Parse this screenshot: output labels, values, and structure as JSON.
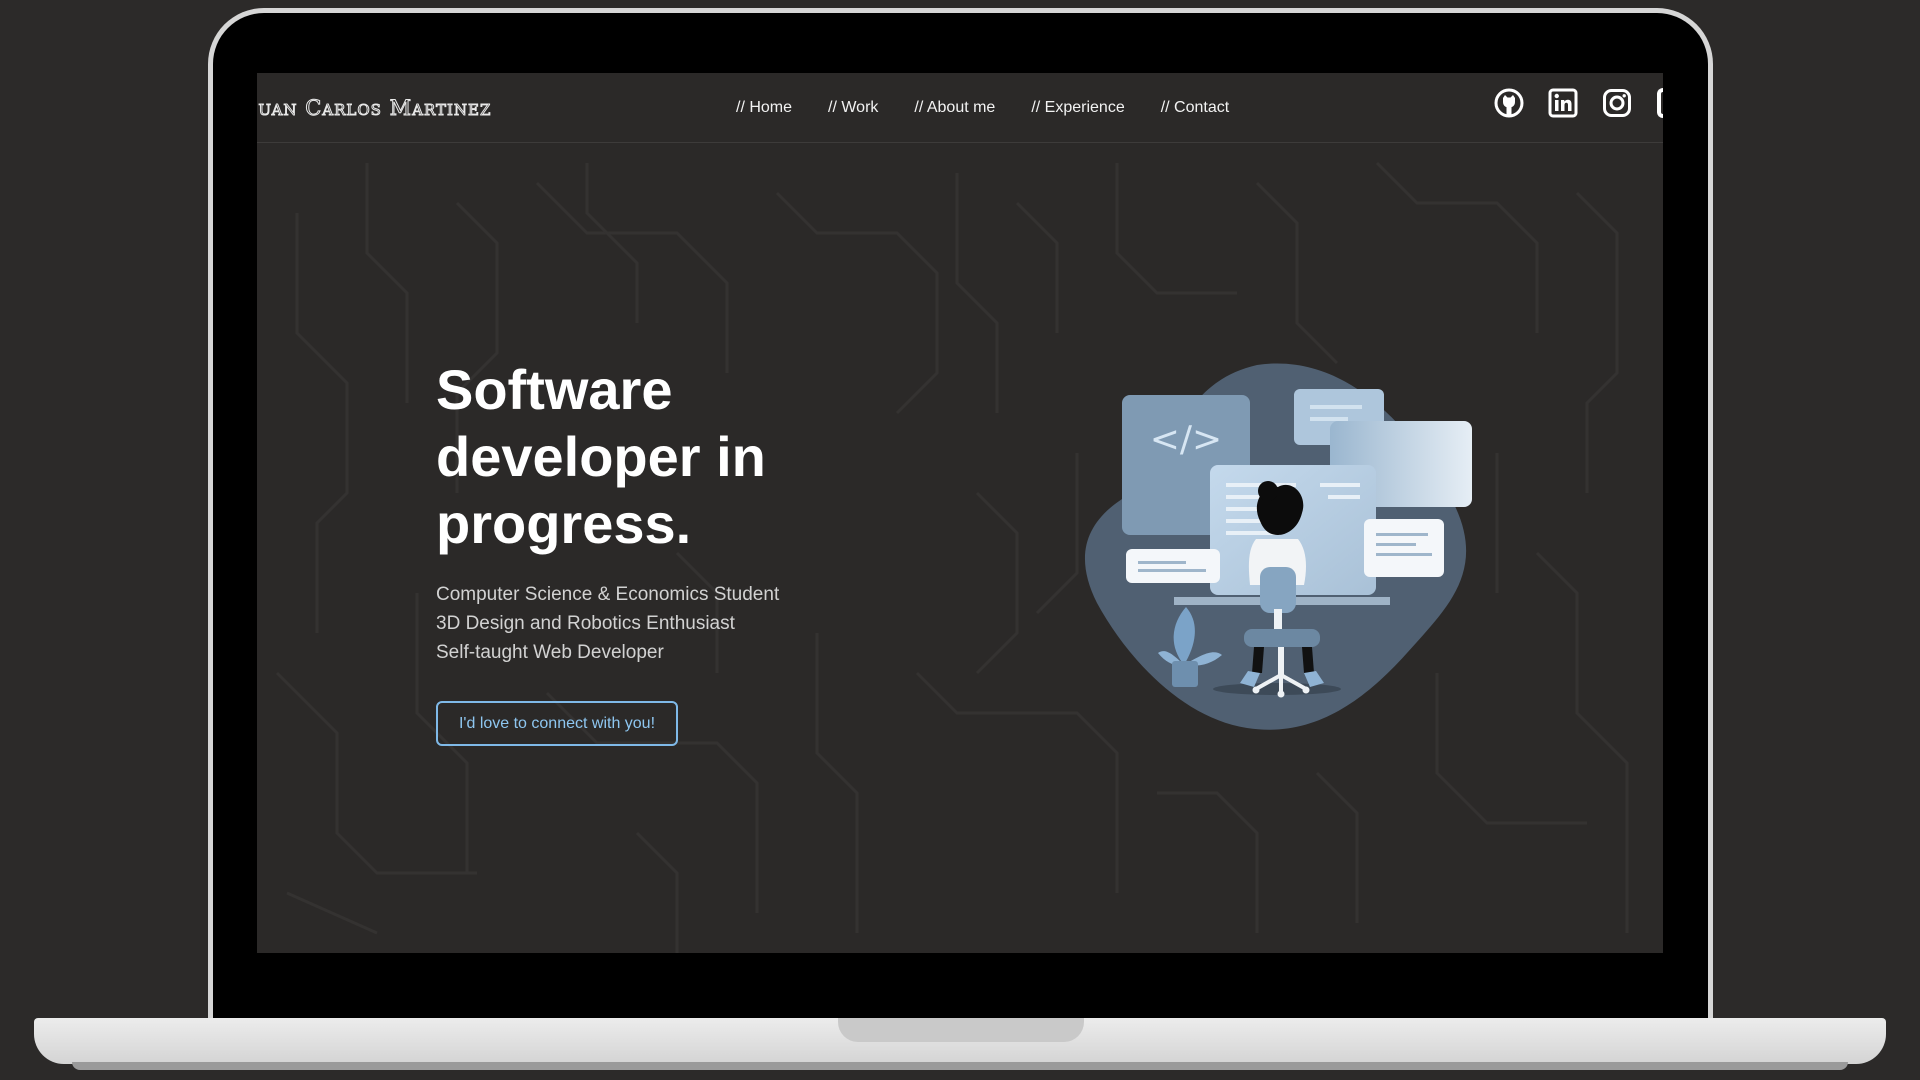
{
  "site": {
    "brand": "Juan Carlos Martinez"
  },
  "nav": {
    "items": [
      {
        "label": "// Home"
      },
      {
        "label": "// Work"
      },
      {
        "label": "// About me"
      },
      {
        "label": "// Experience"
      },
      {
        "label": "// Contact"
      }
    ]
  },
  "socials": {
    "icons": [
      "github-icon",
      "linkedin-icon",
      "instagram-icon"
    ]
  },
  "hero": {
    "title": "Software developer in progress.",
    "lines": [
      "Computer Science & Economics Student",
      "3D Design and Robotics Enthusiast",
      "Self-taught Web Developer"
    ],
    "cta_label": "I'd love to connect with you!",
    "illustration_code_symbol": "</>"
  },
  "colors": {
    "background": "#2b2928",
    "accent": "#8ec6f0",
    "text": "#ffffff",
    "illustration_blue": "#7e9bb5"
  }
}
